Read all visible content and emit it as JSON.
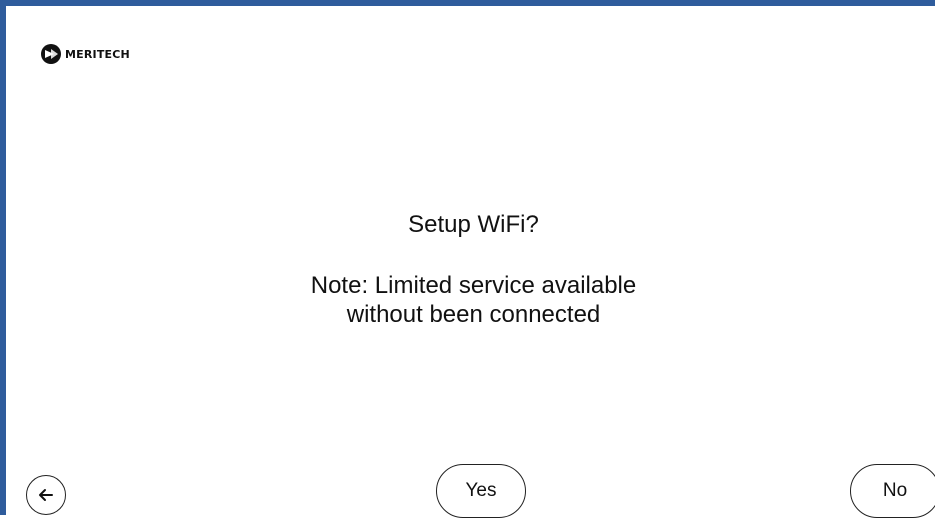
{
  "brand": {
    "name": "MERITECH",
    "logo_icon": "meritech-logo-icon"
  },
  "dialog": {
    "title": "Setup WiFi?",
    "note_line1": "Note: Limited service available",
    "note_line2": "without been connected"
  },
  "actions": {
    "yes_label": "Yes",
    "no_label": "No",
    "back_icon": "arrow-left-icon"
  },
  "colors": {
    "frame_accent": "#2f5c9c",
    "text": "#111111",
    "background": "#ffffff"
  }
}
